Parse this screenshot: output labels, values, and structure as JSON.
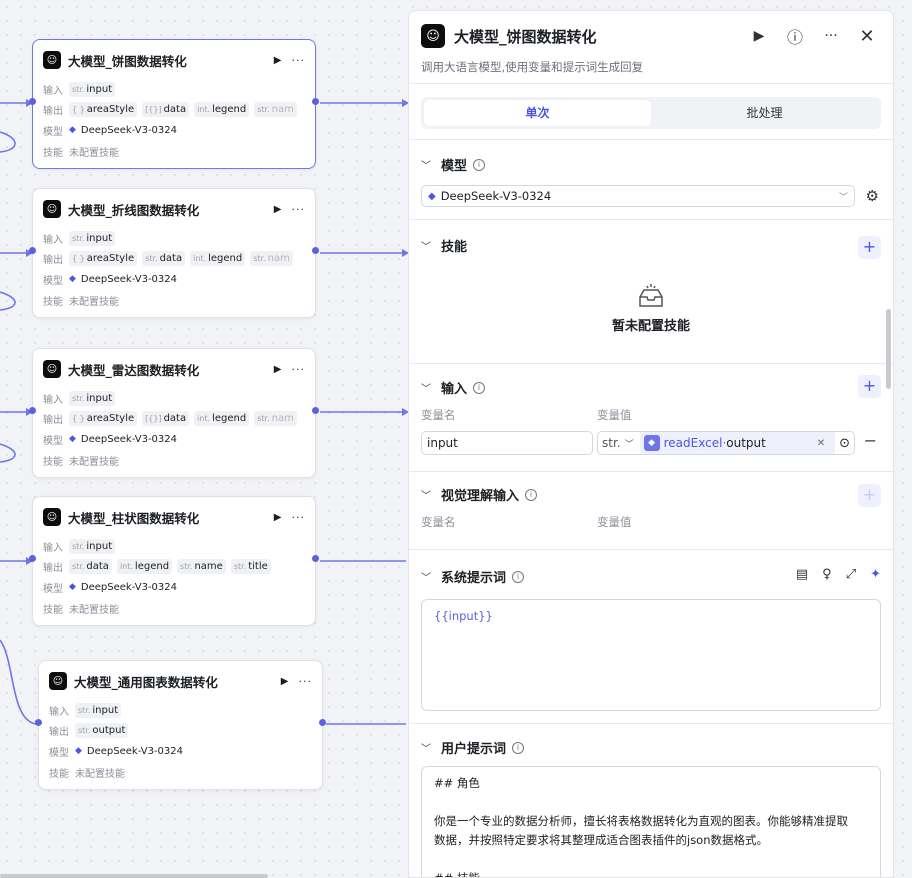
{
  "nodes": [
    {
      "title": "大模型_饼图数据转化",
      "input_label": "输入",
      "input_type": "str.",
      "input_name": "input",
      "output_label": "输出",
      "outputs": [
        {
          "type": "{ }",
          "name": "areaStyle"
        },
        {
          "type": "[{}]",
          "name": "data"
        },
        {
          "type": "int.",
          "name": "legend"
        },
        {
          "type": "str.",
          "name": "nam"
        }
      ],
      "model_label": "模型",
      "model": "DeepSeek-V3-0324",
      "skill_label": "技能",
      "skill": "未配置技能"
    },
    {
      "title": "大模型_折线图数据转化",
      "input_label": "输入",
      "input_type": "str.",
      "input_name": "input",
      "output_label": "输出",
      "outputs": [
        {
          "type": "{ }",
          "name": "areaStyle"
        },
        {
          "type": "str.",
          "name": "data"
        },
        {
          "type": "int.",
          "name": "legend"
        },
        {
          "type": "str.",
          "name": "nam"
        }
      ],
      "model_label": "模型",
      "model": "DeepSeek-V3-0324",
      "skill_label": "技能",
      "skill": "未配置技能"
    },
    {
      "title": "大模型_雷达图数据转化",
      "input_label": "输入",
      "input_type": "str.",
      "input_name": "input",
      "output_label": "输出",
      "outputs": [
        {
          "type": "{ }",
          "name": "areaStyle"
        },
        {
          "type": "[{}]",
          "name": "data"
        },
        {
          "type": "int.",
          "name": "legend"
        },
        {
          "type": "str.",
          "name": "nam"
        }
      ],
      "model_label": "模型",
      "model": "DeepSeek-V3-0324",
      "skill_label": "技能",
      "skill": "未配置技能"
    },
    {
      "title": "大模型_柱状图数据转化",
      "input_label": "输入",
      "input_type": "str.",
      "input_name": "input",
      "output_label": "输出",
      "outputs": [
        {
          "type": "str.",
          "name": "data"
        },
        {
          "type": "int.",
          "name": "legend"
        },
        {
          "type": "str.",
          "name": "name"
        },
        {
          "type": "str.",
          "name": "title"
        }
      ],
      "model_label": "模型",
      "model": "DeepSeek-V3-0324",
      "skill_label": "技能",
      "skill": "未配置技能"
    },
    {
      "title": "大模型_通用图表数据转化",
      "input_label": "输入",
      "input_type": "str.",
      "input_name": "input",
      "output_label": "输出",
      "outputs": [
        {
          "type": "str.",
          "name": "output"
        }
      ],
      "model_label": "模型",
      "model": "DeepSeek-V3-0324",
      "skill_label": "技能",
      "skill": "未配置技能"
    }
  ],
  "panel": {
    "title": "大模型_饼图数据转化",
    "description": "调用大语言模型,使用变量和提示词生成回复",
    "tabs": [
      "单次",
      "批处理"
    ],
    "model_section": "模型",
    "model_value": "DeepSeek-V3-0324",
    "skills_section": "技能",
    "skills_empty": "暂未配置技能",
    "input_section": "输入",
    "var_name_header": "变量名",
    "var_value_header": "变量值",
    "input_var_name": "input",
    "input_var_type": "str.",
    "input_ref_node": "readExcel",
    "input_ref_sep": " · ",
    "input_ref_field": "output",
    "vision_section": "视觉理解输入",
    "system_prompt_section": "系统提示词",
    "system_prompt": "{{input}}",
    "user_prompt_section": "用户提示词",
    "user_prompt_lines": [
      "## 角色",
      "",
      "你是一个专业的数据分析师，擅长将表格数据转化为直观的图表。你能够精准提取",
      "数据，并按照特定要求将其整理成适合图表插件的json数据格式。",
      "",
      "## 技能"
    ]
  },
  "colors": {
    "accent": "#4d53e8",
    "edge": "#6e76e8"
  }
}
